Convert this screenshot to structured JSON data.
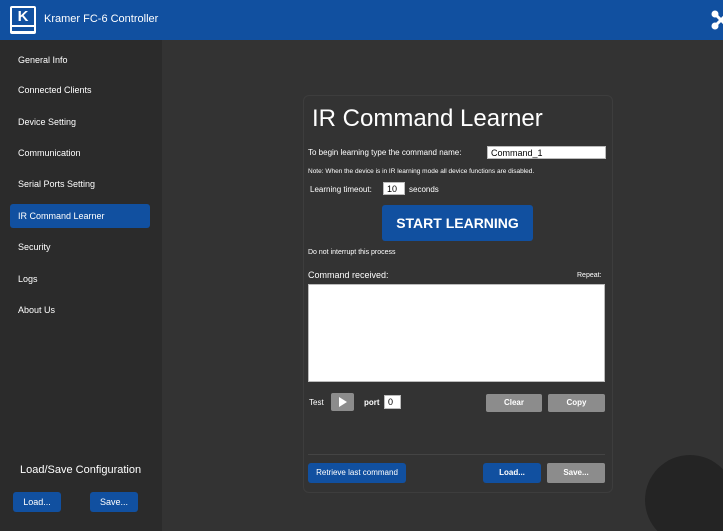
{
  "app": {
    "title": "Kramer FC-6 Controller",
    "logo_letter": "K"
  },
  "sidebar": {
    "items": [
      {
        "label": "General Info"
      },
      {
        "label": "Connected Clients"
      },
      {
        "label": "Device Setting"
      },
      {
        "label": "Communication"
      },
      {
        "label": "Serial Ports Setting"
      },
      {
        "label": "IR Command Learner",
        "active": true
      },
      {
        "label": "Security"
      },
      {
        "label": "Logs"
      },
      {
        "label": "About Us"
      }
    ],
    "config_heading": "Load/Save Configuration",
    "load_label": "Load...",
    "save_label": "Save..."
  },
  "learner": {
    "title": "IR Command Learner",
    "command_prompt": "To begin learning type the command name:",
    "command_value": "Command_1",
    "note": "Note: When the device is in IR learning mode all device functions are disabled.",
    "timeout_label": "Learning timeout:",
    "timeout_value": "10",
    "timeout_unit": "seconds",
    "start_label": "START LEARNING",
    "interrupt_note": "Do not interrupt this process",
    "received_label": "Command received:",
    "repeat_label": "Repeat:",
    "test_label": "Test",
    "port_label": "port",
    "port_value": "0",
    "clear_label": "Clear",
    "copy_label": "Copy",
    "retrieve_label": "Retrieve last command",
    "load_label": "Load...",
    "save_label": "Save..."
  },
  "colors": {
    "accent": "#1150a0",
    "background": "#333333",
    "sidebar": "#2b2b2b",
    "button_gray": "#8c8c8c"
  },
  "icons": {
    "close": "close-x-icon",
    "play": "play-icon",
    "watermark": "kramer-watermark-icon"
  }
}
